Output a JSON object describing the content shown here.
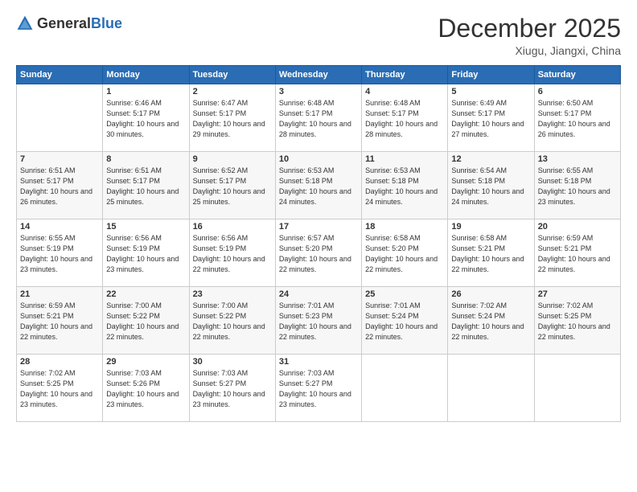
{
  "logo": {
    "general": "General",
    "blue": "Blue"
  },
  "header": {
    "month_title": "December 2025",
    "location": "Xiugu, Jiangxi, China"
  },
  "weekdays": [
    "Sunday",
    "Monday",
    "Tuesday",
    "Wednesday",
    "Thursday",
    "Friday",
    "Saturday"
  ],
  "weeks": [
    [
      {
        "day": "",
        "sunrise": "",
        "sunset": "",
        "daylight": ""
      },
      {
        "day": "1",
        "sunrise": "Sunrise: 6:46 AM",
        "sunset": "Sunset: 5:17 PM",
        "daylight": "Daylight: 10 hours and 30 minutes."
      },
      {
        "day": "2",
        "sunrise": "Sunrise: 6:47 AM",
        "sunset": "Sunset: 5:17 PM",
        "daylight": "Daylight: 10 hours and 29 minutes."
      },
      {
        "day": "3",
        "sunrise": "Sunrise: 6:48 AM",
        "sunset": "Sunset: 5:17 PM",
        "daylight": "Daylight: 10 hours and 28 minutes."
      },
      {
        "day": "4",
        "sunrise": "Sunrise: 6:48 AM",
        "sunset": "Sunset: 5:17 PM",
        "daylight": "Daylight: 10 hours and 28 minutes."
      },
      {
        "day": "5",
        "sunrise": "Sunrise: 6:49 AM",
        "sunset": "Sunset: 5:17 PM",
        "daylight": "Daylight: 10 hours and 27 minutes."
      },
      {
        "day": "6",
        "sunrise": "Sunrise: 6:50 AM",
        "sunset": "Sunset: 5:17 PM",
        "daylight": "Daylight: 10 hours and 26 minutes."
      }
    ],
    [
      {
        "day": "7",
        "sunrise": "Sunrise: 6:51 AM",
        "sunset": "Sunset: 5:17 PM",
        "daylight": "Daylight: 10 hours and 26 minutes."
      },
      {
        "day": "8",
        "sunrise": "Sunrise: 6:51 AM",
        "sunset": "Sunset: 5:17 PM",
        "daylight": "Daylight: 10 hours and 25 minutes."
      },
      {
        "day": "9",
        "sunrise": "Sunrise: 6:52 AM",
        "sunset": "Sunset: 5:17 PM",
        "daylight": "Daylight: 10 hours and 25 minutes."
      },
      {
        "day": "10",
        "sunrise": "Sunrise: 6:53 AM",
        "sunset": "Sunset: 5:18 PM",
        "daylight": "Daylight: 10 hours and 24 minutes."
      },
      {
        "day": "11",
        "sunrise": "Sunrise: 6:53 AM",
        "sunset": "Sunset: 5:18 PM",
        "daylight": "Daylight: 10 hours and 24 minutes."
      },
      {
        "day": "12",
        "sunrise": "Sunrise: 6:54 AM",
        "sunset": "Sunset: 5:18 PM",
        "daylight": "Daylight: 10 hours and 24 minutes."
      },
      {
        "day": "13",
        "sunrise": "Sunrise: 6:55 AM",
        "sunset": "Sunset: 5:18 PM",
        "daylight": "Daylight: 10 hours and 23 minutes."
      }
    ],
    [
      {
        "day": "14",
        "sunrise": "Sunrise: 6:55 AM",
        "sunset": "Sunset: 5:19 PM",
        "daylight": "Daylight: 10 hours and 23 minutes."
      },
      {
        "day": "15",
        "sunrise": "Sunrise: 6:56 AM",
        "sunset": "Sunset: 5:19 PM",
        "daylight": "Daylight: 10 hours and 23 minutes."
      },
      {
        "day": "16",
        "sunrise": "Sunrise: 6:56 AM",
        "sunset": "Sunset: 5:19 PM",
        "daylight": "Daylight: 10 hours and 22 minutes."
      },
      {
        "day": "17",
        "sunrise": "Sunrise: 6:57 AM",
        "sunset": "Sunset: 5:20 PM",
        "daylight": "Daylight: 10 hours and 22 minutes."
      },
      {
        "day": "18",
        "sunrise": "Sunrise: 6:58 AM",
        "sunset": "Sunset: 5:20 PM",
        "daylight": "Daylight: 10 hours and 22 minutes."
      },
      {
        "day": "19",
        "sunrise": "Sunrise: 6:58 AM",
        "sunset": "Sunset: 5:21 PM",
        "daylight": "Daylight: 10 hours and 22 minutes."
      },
      {
        "day": "20",
        "sunrise": "Sunrise: 6:59 AM",
        "sunset": "Sunset: 5:21 PM",
        "daylight": "Daylight: 10 hours and 22 minutes."
      }
    ],
    [
      {
        "day": "21",
        "sunrise": "Sunrise: 6:59 AM",
        "sunset": "Sunset: 5:21 PM",
        "daylight": "Daylight: 10 hours and 22 minutes."
      },
      {
        "day": "22",
        "sunrise": "Sunrise: 7:00 AM",
        "sunset": "Sunset: 5:22 PM",
        "daylight": "Daylight: 10 hours and 22 minutes."
      },
      {
        "day": "23",
        "sunrise": "Sunrise: 7:00 AM",
        "sunset": "Sunset: 5:22 PM",
        "daylight": "Daylight: 10 hours and 22 minutes."
      },
      {
        "day": "24",
        "sunrise": "Sunrise: 7:01 AM",
        "sunset": "Sunset: 5:23 PM",
        "daylight": "Daylight: 10 hours and 22 minutes."
      },
      {
        "day": "25",
        "sunrise": "Sunrise: 7:01 AM",
        "sunset": "Sunset: 5:24 PM",
        "daylight": "Daylight: 10 hours and 22 minutes."
      },
      {
        "day": "26",
        "sunrise": "Sunrise: 7:02 AM",
        "sunset": "Sunset: 5:24 PM",
        "daylight": "Daylight: 10 hours and 22 minutes."
      },
      {
        "day": "27",
        "sunrise": "Sunrise: 7:02 AM",
        "sunset": "Sunset: 5:25 PM",
        "daylight": "Daylight: 10 hours and 22 minutes."
      }
    ],
    [
      {
        "day": "28",
        "sunrise": "Sunrise: 7:02 AM",
        "sunset": "Sunset: 5:25 PM",
        "daylight": "Daylight: 10 hours and 23 minutes."
      },
      {
        "day": "29",
        "sunrise": "Sunrise: 7:03 AM",
        "sunset": "Sunset: 5:26 PM",
        "daylight": "Daylight: 10 hours and 23 minutes."
      },
      {
        "day": "30",
        "sunrise": "Sunrise: 7:03 AM",
        "sunset": "Sunset: 5:27 PM",
        "daylight": "Daylight: 10 hours and 23 minutes."
      },
      {
        "day": "31",
        "sunrise": "Sunrise: 7:03 AM",
        "sunset": "Sunset: 5:27 PM",
        "daylight": "Daylight: 10 hours and 23 minutes."
      },
      {
        "day": "",
        "sunrise": "",
        "sunset": "",
        "daylight": ""
      },
      {
        "day": "",
        "sunrise": "",
        "sunset": "",
        "daylight": ""
      },
      {
        "day": "",
        "sunrise": "",
        "sunset": "",
        "daylight": ""
      }
    ]
  ]
}
